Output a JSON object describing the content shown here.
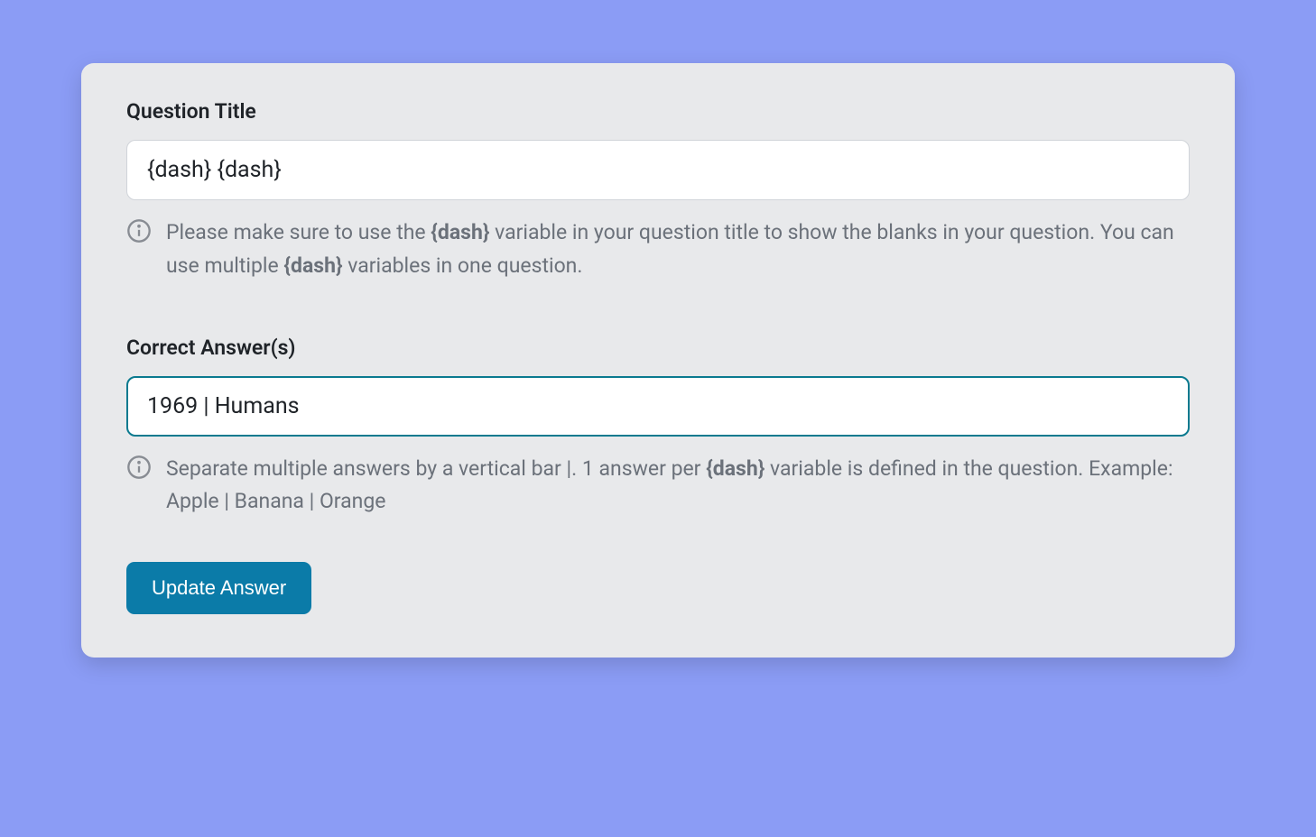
{
  "form": {
    "question_title": {
      "label": "Question Title",
      "value": "{dash} {dash}",
      "help_before": "Please make sure to use the ",
      "help_bold1": "{dash}",
      "help_mid": " variable in your question title to show the blanks in your question. You can use multiple ",
      "help_bold2": "{dash}",
      "help_after": " variables in one question."
    },
    "correct_answers": {
      "label": "Correct Answer(s)",
      "value": "1969 | Humans",
      "help_before": "Separate multiple answers by a vertical bar |. 1 answer per ",
      "help_bold": "{dash}",
      "help_after": " variable is defined in the question. Example: Apple | Banana | Orange"
    },
    "submit_label": "Update Answer"
  }
}
